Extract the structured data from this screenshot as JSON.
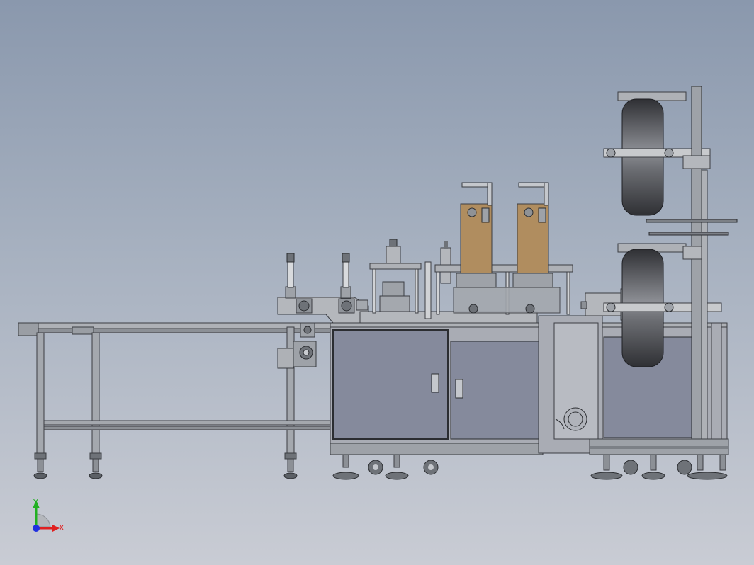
{
  "viewport": {
    "background_top": "#8a98ad",
    "background_bottom": "#c9ccd4"
  },
  "colors": {
    "frame": "#9ea2a8",
    "frame_dark": "#3b3d42",
    "panel": "#858a9c",
    "panel_light": "#a9acb8",
    "bronze": "#b08d5f",
    "roll": "#3a3b3f",
    "roll_highlight": "#8d8f95",
    "axis_x": "#e02020",
    "axis_y": "#22b022",
    "axis_z": "#2030e0"
  },
  "triad": {
    "x_label": "X",
    "y_label": "Y"
  }
}
